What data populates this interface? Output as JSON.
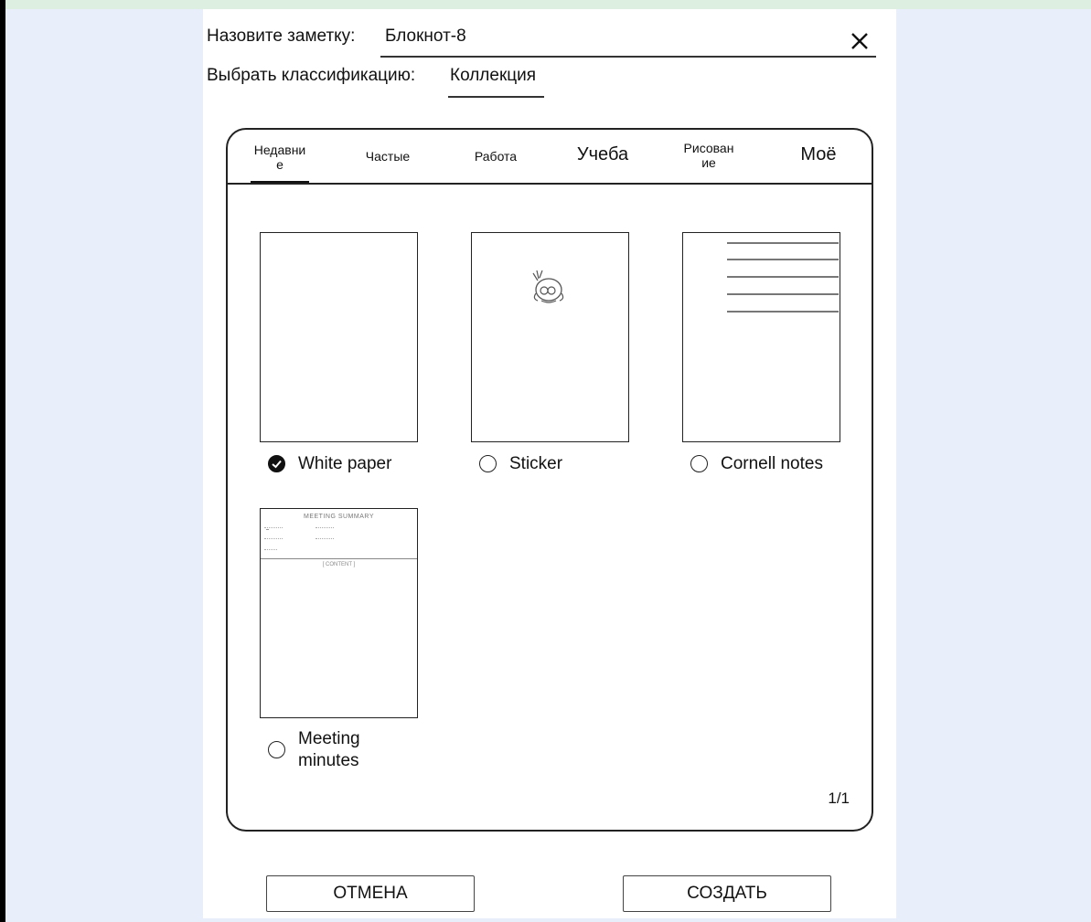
{
  "dialog": {
    "name_label": "Назовите заметку:",
    "name_value": "Блокнот-8",
    "class_label": "Выбрать классификацию:",
    "class_value": "Коллекция",
    "close_icon": "close-icon"
  },
  "tabs": [
    {
      "label": "Недавни\nе",
      "active": true
    },
    {
      "label": "Частые",
      "active": false
    },
    {
      "label": "Работа",
      "active": false
    },
    {
      "label": "Учеба",
      "active": false
    },
    {
      "label": "Рисован\nие",
      "active": false
    },
    {
      "label": "Моё",
      "active": false
    }
  ],
  "templates": [
    {
      "label": "White paper",
      "selected": true,
      "preview": "blank"
    },
    {
      "label": "Sticker",
      "selected": false,
      "preview": "sticker-icon"
    },
    {
      "label": "Cornell notes",
      "selected": false,
      "preview": "lined"
    },
    {
      "label": "Meeting\nminutes",
      "selected": false,
      "preview": "meeting-summary",
      "preview_title": "MEETING SUMMARY",
      "preview_section": "[ CONTENT ]"
    }
  ],
  "pagination": "1/1",
  "buttons": {
    "cancel": "ОТМЕНА",
    "create": "СОЗДАТЬ"
  },
  "colors": {
    "accent": "#111111",
    "background": "#e8eefa",
    "top_band": "#dcefe0"
  }
}
